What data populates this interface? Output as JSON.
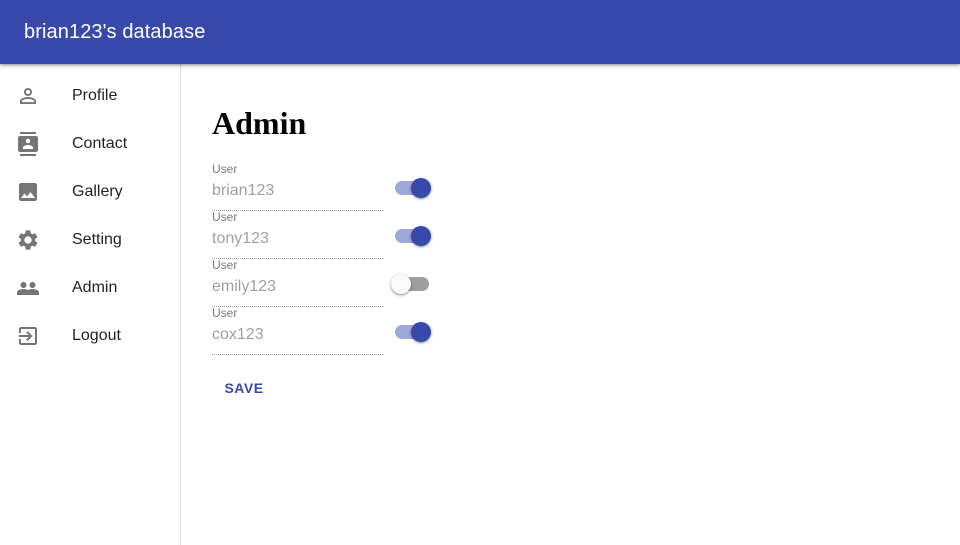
{
  "appbar": {
    "title": "brian123's database",
    "color": "#3949ab"
  },
  "sidebar": {
    "items": [
      {
        "label": "Profile",
        "icon": "person-icon"
      },
      {
        "label": "Contact",
        "icon": "contact-card-icon"
      },
      {
        "label": "Gallery",
        "icon": "image-icon"
      },
      {
        "label": "Setting",
        "icon": "gear-icon"
      },
      {
        "label": "Admin",
        "icon": "group-icon"
      },
      {
        "label": "Logout",
        "icon": "logout-icon"
      }
    ]
  },
  "main": {
    "title": "Admin",
    "users": [
      {
        "field_label": "User",
        "placeholder": "brian123",
        "enabled": true
      },
      {
        "field_label": "User",
        "placeholder": "tony123",
        "enabled": true
      },
      {
        "field_label": "User",
        "placeholder": "emily123",
        "enabled": false
      },
      {
        "field_label": "User",
        "placeholder": "cox123",
        "enabled": true
      }
    ],
    "save_label": "SAVE"
  },
  "colors": {
    "accent": "#3949ab",
    "switch_track_on": "#9fa8da",
    "switch_track_off": "#9e9e9e"
  }
}
